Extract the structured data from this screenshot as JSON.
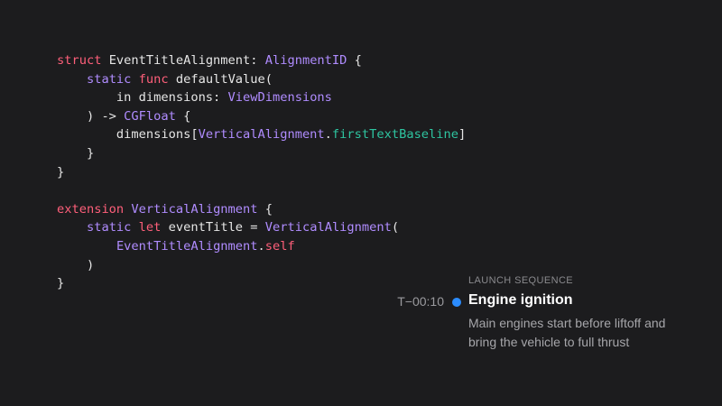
{
  "colors": {
    "background": "#1c1c1e",
    "keyword": "#ff5f7a",
    "type": "#b08cff",
    "member": "#2ec4a0",
    "plain": "#e6e6e6",
    "dot": "#2b8cff"
  },
  "code": {
    "lines": [
      [
        {
          "t": "keyword",
          "s": "struct"
        },
        {
          "t": "plain",
          "s": " EventTitleAlignment: "
        },
        {
          "t": "type",
          "s": "AlignmentID"
        },
        {
          "t": "plain",
          "s": " {"
        }
      ],
      [
        {
          "t": "plain",
          "s": "    "
        },
        {
          "t": "type",
          "s": "static"
        },
        {
          "t": "plain",
          "s": " "
        },
        {
          "t": "keyword",
          "s": "func"
        },
        {
          "t": "plain",
          "s": " defaultValue("
        }
      ],
      [
        {
          "t": "plain",
          "s": "        in dimensions: "
        },
        {
          "t": "type",
          "s": "ViewDimensions"
        }
      ],
      [
        {
          "t": "plain",
          "s": "    ) -> "
        },
        {
          "t": "type",
          "s": "CGFloat"
        },
        {
          "t": "plain",
          "s": " {"
        }
      ],
      [
        {
          "t": "plain",
          "s": "        dimensions["
        },
        {
          "t": "type",
          "s": "VerticalAlignment"
        },
        {
          "t": "plain",
          "s": "."
        },
        {
          "t": "member",
          "s": "firstTextBaseline"
        },
        {
          "t": "plain",
          "s": "]"
        }
      ],
      [
        {
          "t": "plain",
          "s": "    }"
        }
      ],
      [
        {
          "t": "plain",
          "s": "}"
        }
      ],
      [
        {
          "t": "plain",
          "s": ""
        }
      ],
      [
        {
          "t": "keyword",
          "s": "extension"
        },
        {
          "t": "plain",
          "s": " "
        },
        {
          "t": "type",
          "s": "VerticalAlignment"
        },
        {
          "t": "plain",
          "s": " {"
        }
      ],
      [
        {
          "t": "plain",
          "s": "    "
        },
        {
          "t": "type",
          "s": "static"
        },
        {
          "t": "plain",
          "s": " "
        },
        {
          "t": "keyword",
          "s": "let"
        },
        {
          "t": "plain",
          "s": " eventTitle = "
        },
        {
          "t": "type",
          "s": "VerticalAlignment"
        },
        {
          "t": "plain",
          "s": "("
        }
      ],
      [
        {
          "t": "plain",
          "s": "        "
        },
        {
          "t": "type",
          "s": "EventTitleAlignment"
        },
        {
          "t": "plain",
          "s": "."
        },
        {
          "t": "keyword",
          "s": "self"
        }
      ],
      [
        {
          "t": "plain",
          "s": "    )"
        }
      ],
      [
        {
          "t": "plain",
          "s": "}"
        }
      ]
    ]
  },
  "timeline": {
    "section_label": "LAUNCH SEQUENCE",
    "event": {
      "time": "T−00:10",
      "title": "Engine ignition",
      "description_lines": [
        "Main engines start before liftoff and",
        "bring the vehicle to full thrust"
      ]
    }
  }
}
